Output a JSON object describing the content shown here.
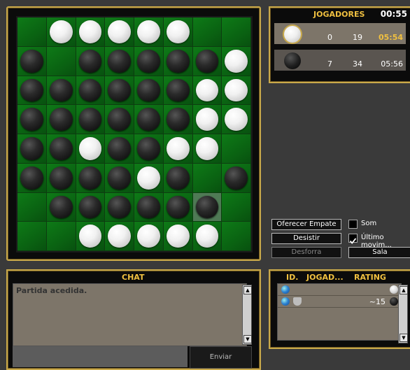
{
  "board": {
    "rows": [
      [
        "",
        "W",
        "W",
        "W",
        "W",
        "W",
        "",
        ""
      ],
      [
        "B",
        "",
        "B",
        "B",
        "B",
        "B",
        "B",
        "W"
      ],
      [
        "B",
        "B",
        "B",
        "B",
        "B",
        "B",
        "W",
        "W"
      ],
      [
        "B",
        "B",
        "B",
        "B",
        "B",
        "B",
        "W",
        "W"
      ],
      [
        "B",
        "B",
        "W",
        "B",
        "B",
        "W",
        "W",
        ""
      ],
      [
        "B",
        "B",
        "B",
        "B",
        "W",
        "B",
        "",
        "B"
      ],
      [
        "",
        "B",
        "B",
        "B",
        "B",
        "B",
        "B",
        ""
      ],
      [
        "",
        "",
        "W",
        "W",
        "W",
        "W",
        "W",
        ""
      ]
    ],
    "last_move": {
      "row": 6,
      "col": 6
    }
  },
  "players_panel": {
    "title": "JOGADORES",
    "time": "00:55",
    "players": [
      {
        "disc": "white",
        "a": "0",
        "b": "19",
        "time": "05:54",
        "time_color": "#f0c040",
        "active": true
      },
      {
        "disc": "black",
        "a": "7",
        "b": "34",
        "time": "05:56",
        "time_color": "#ffffff",
        "active": false
      }
    ]
  },
  "controls": {
    "offer_draw": "Oferecer Empate",
    "sound_label": "Som",
    "resign": "Desistir",
    "last_move_label": "Último movim...",
    "rematch": "Desforra",
    "room": "Sala"
  },
  "chat": {
    "title": "CHAT",
    "log": "Partida acedida.",
    "send": "Enviar"
  },
  "room_list": {
    "col_id": "ID.",
    "col_player": "JOGAD...",
    "col_rating": "RATING",
    "rows": [
      {
        "rating": "",
        "disc": "white"
      },
      {
        "rating": "~15",
        "disc": "black"
      }
    ]
  }
}
